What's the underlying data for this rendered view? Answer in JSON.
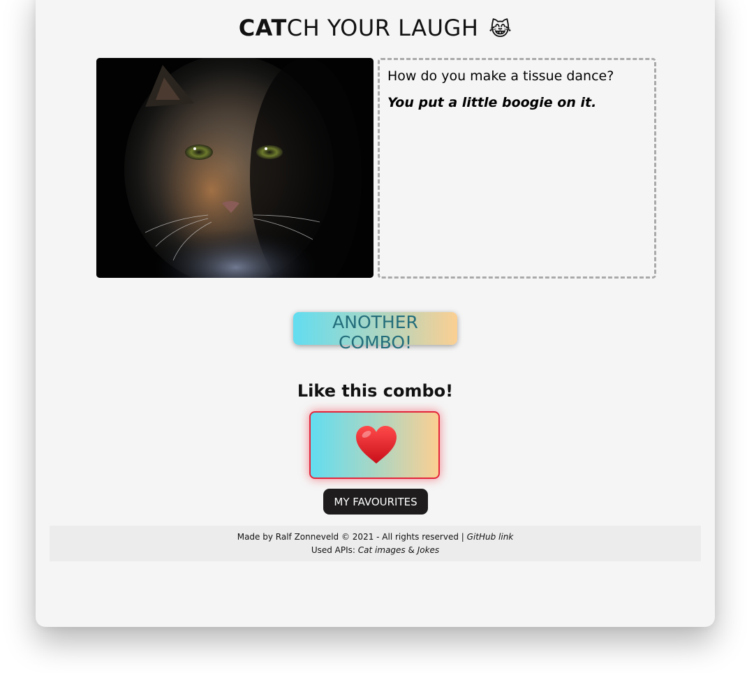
{
  "header": {
    "title_bold": "CAT",
    "title_rest": "CH YOUR LAUGH",
    "title_emoji": "😹"
  },
  "cat_image": {
    "alt": "Cat image",
    "icon": "cat-photo"
  },
  "joke": {
    "setup": "How do you make a tissue dance?",
    "punchline": "You put a little boogie on it."
  },
  "actions": {
    "another_combo_label": "ANOTHER COMBO!",
    "like_heading": "Like this combo!",
    "like_icon": "heart-icon",
    "favourites_label": "MY FAVOURITES"
  },
  "footer": {
    "credits": "Made by Ralf Zonneveld © 2021 - All rights reserved |",
    "github_link": "GitHub link",
    "apis_label": "Used APIs:",
    "cat_images_link": "Cat images",
    "ampersand": "&",
    "jokes_link": "Jokes"
  },
  "colors": {
    "gradient_start": "#62ddf0",
    "gradient_end": "#fbcf92",
    "combo_text": "#236d7b",
    "like_border": "#e3253a",
    "favourites_bg": "#1e1c1d"
  }
}
